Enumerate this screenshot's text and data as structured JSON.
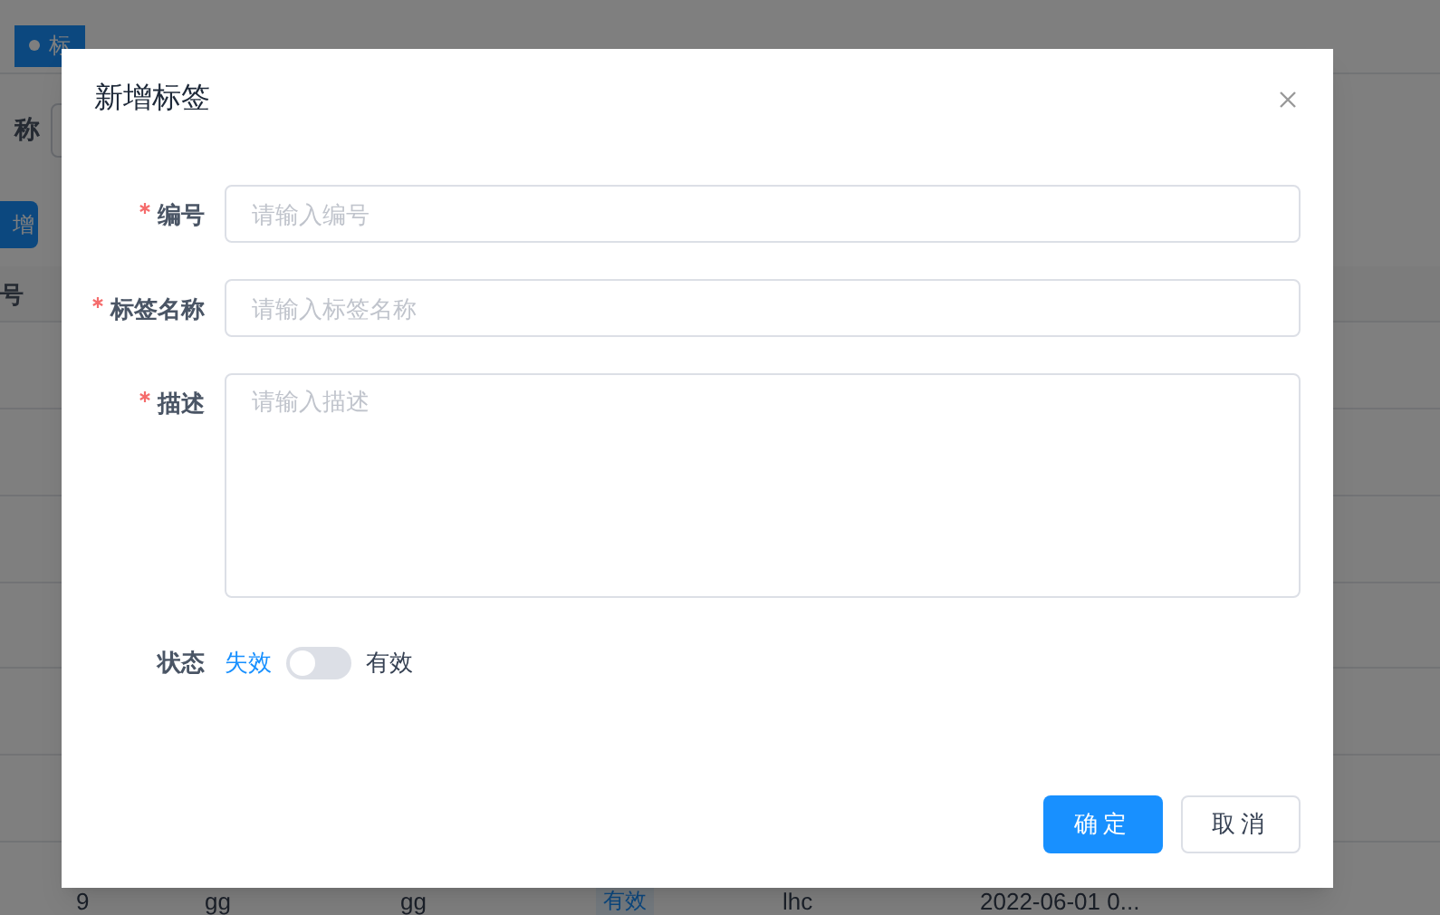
{
  "background_page": {
    "tab": {
      "label": "标"
    },
    "filter_label": "称",
    "add_button": "增",
    "table": {
      "column_header": "号",
      "rows": [
        {
          "cells": [
            "9",
            "gg",
            "gg",
            "有效",
            "lhc",
            "2022-06-01 0..."
          ]
        }
      ]
    }
  },
  "dialog": {
    "title": "新增标签",
    "fields": [
      {
        "kind": "input",
        "label": "编号",
        "required": true,
        "placeholder": "请输入编号"
      },
      {
        "kind": "textarea_short",
        "label": "标签名称",
        "required": true,
        "placeholder": "请输入标签名称"
      },
      {
        "kind": "textarea",
        "label": "描述",
        "required": true,
        "placeholder": "请输入描述"
      }
    ],
    "status": {
      "label": "状态",
      "off_label": "失效",
      "on_label": "有效",
      "on": false
    },
    "buttons": [
      {
        "kind": "primary",
        "label": "确定"
      },
      {
        "kind": "default",
        "label": "取消"
      }
    ]
  }
}
